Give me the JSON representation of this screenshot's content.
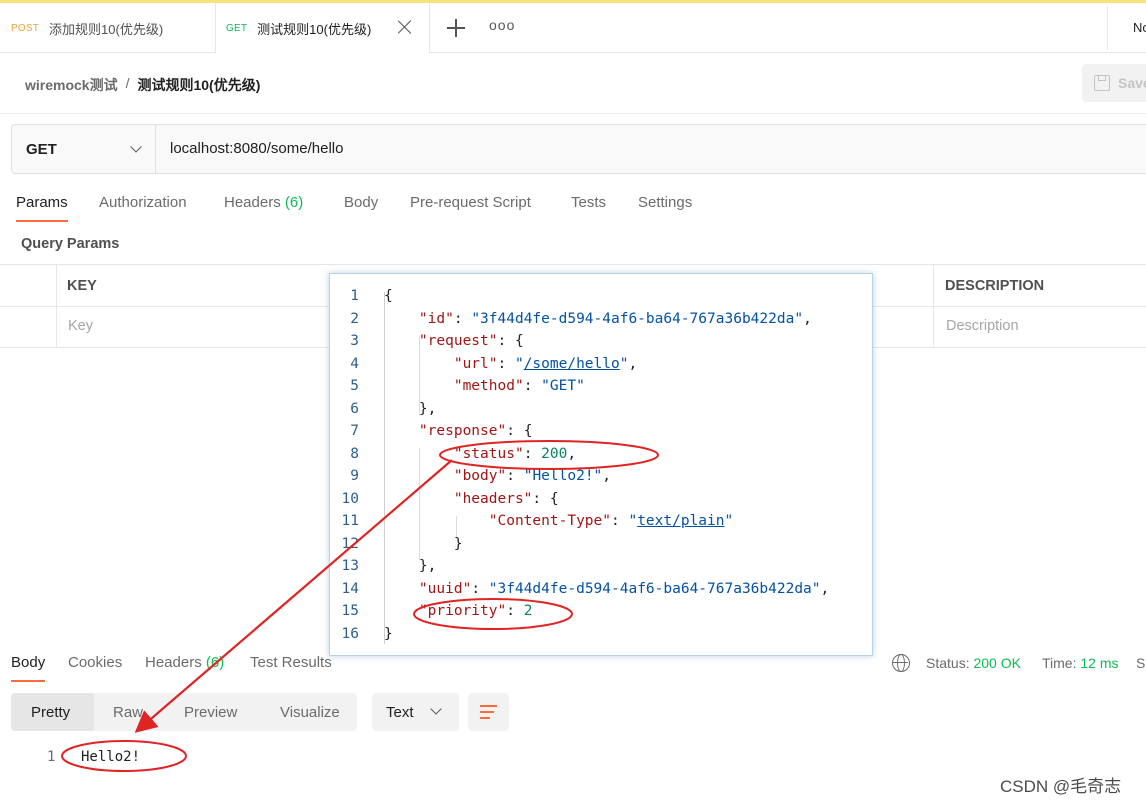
{
  "tabs": [
    {
      "method": "POST",
      "title": "添加规则10(优先级)"
    },
    {
      "method": "GET",
      "title": "测试规则10(优先级)"
    }
  ],
  "tab_more": "ooo",
  "env_label": "No",
  "breadcrumb": {
    "parent": "wiremock测试",
    "separator": "/",
    "current": "测试规则10(优先级)"
  },
  "save_label": "Save",
  "request": {
    "method": "GET",
    "url": "localhost:8080/some/hello"
  },
  "request_tabs": [
    {
      "label": "Params"
    },
    {
      "label": "Authorization"
    },
    {
      "label": "Headers",
      "count": "(6)"
    },
    {
      "label": "Body"
    },
    {
      "label": "Pre-request Script"
    },
    {
      "label": "Tests"
    },
    {
      "label": "Settings"
    }
  ],
  "query_params": {
    "title": "Query Params",
    "headers": {
      "key": "KEY",
      "description": "DESCRIPTION"
    },
    "placeholders": {
      "key": "Key",
      "description": "Description"
    }
  },
  "code_popup": {
    "line_numbers": [
      "1",
      "2",
      "3",
      "4",
      "5",
      "6",
      "7",
      "8",
      "9",
      "10",
      "11",
      "12",
      "13",
      "14",
      "15",
      "16"
    ],
    "id": "3f44d4fe-d594-4af6-ba64-767a36b422da",
    "url": "/some/hello",
    "method": "GET",
    "status": "200",
    "body": "Hello2!",
    "content_type": "text/plain",
    "uuid": "3f44d4fe-d594-4af6-ba64-767a36b422da",
    "priority": "2"
  },
  "response_tabs": [
    {
      "label": "Body"
    },
    {
      "label": "Cookies"
    },
    {
      "label": "Headers",
      "count": "(6)"
    },
    {
      "label": "Test Results"
    }
  ],
  "response_meta": {
    "status_label": "Status:",
    "status_value": "200 OK",
    "time_label": "Time:",
    "time_value": "12 ms",
    "size_label": "Si"
  },
  "view_modes": [
    "Pretty",
    "Raw",
    "Preview",
    "Visualize"
  ],
  "format": "Text",
  "response_body": {
    "line": "1",
    "text": "Hello2!"
  },
  "watermark": "CSDN @毛奇志",
  "colors": {
    "accent": "#ff6c37",
    "get": "#0cbb52",
    "post": "#e8a33d",
    "annotation": "#e02424"
  }
}
